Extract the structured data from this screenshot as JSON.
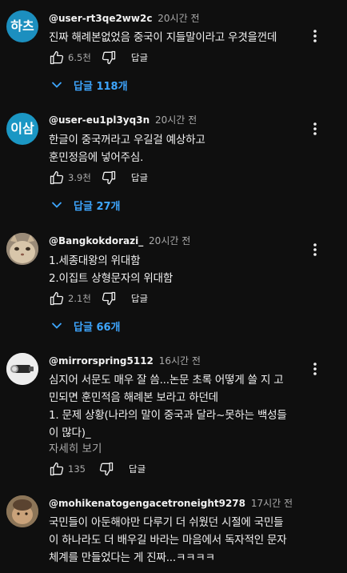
{
  "colors": {
    "background": "#0f0f0f",
    "text": "#f1f1f1",
    "secondary": "#aaaaaa",
    "link": "#3ea6ff"
  },
  "comments": [
    {
      "avatar_text": "하츠",
      "avatar_color": "#1c8fbf",
      "username": "@user-rt3qe2ww2c",
      "time": "20시간 전",
      "lines": [
        "진짜 해례본없었음 중국이 지들말이라고 우겻을껀데"
      ],
      "likes": "6.5천",
      "reply_label": "답글",
      "replies_label": "답글 118개"
    },
    {
      "avatar_text": "이삼",
      "avatar_color": "#1b97c4",
      "username": "@user-eu1pl3yq3n",
      "time": "20시간 전",
      "lines": [
        "한글이 중국꺼라고 우길걸 예상하고",
        "훈민정음에 넣어주심."
      ],
      "likes": "3.9천",
      "reply_label": "답글",
      "replies_label": "답글 27개"
    },
    {
      "avatar_text": "",
      "avatar_color": "#b8a48a",
      "username": "@Bangkokdorazi_",
      "time": "20시간 전",
      "lines": [
        "1.세종대왕의 위대함",
        "2.이집트 상형문자의 위대함"
      ],
      "likes": "2.1천",
      "reply_label": "답글",
      "replies_label": "답글 66개"
    },
    {
      "avatar_text": "",
      "avatar_color": "#e6e6e6",
      "username": "@mirrorspring5112",
      "time": "16시간 전",
      "lines": [
        "심지어 서문도 매우 잘 씀...논문 초록 어떻게 쓸 지 고",
        "민되면 훈민적음 해례본 보라고 하던데",
        "1. 문제 상황(나라의 말이 중국과 달라~못하는 백성들",
        "이 많다)_"
      ],
      "more_label": "자세히 보기",
      "likes": "135",
      "reply_label": "답글"
    },
    {
      "avatar_text": "",
      "avatar_color": "#a08868",
      "username": "@mohikenatogengacetroneight9278",
      "time": "17시간 전",
      "lines": [
        "국민들이 아둔해야만 다루기 더 쉬웠던 시절에 국민들",
        "이 하나라도 더 배우길 바라는 마음에서 독자적인 문자",
        "체계를 만들었다는 게 진짜...ㅋㅋㅋㅋ"
      ]
    }
  ]
}
